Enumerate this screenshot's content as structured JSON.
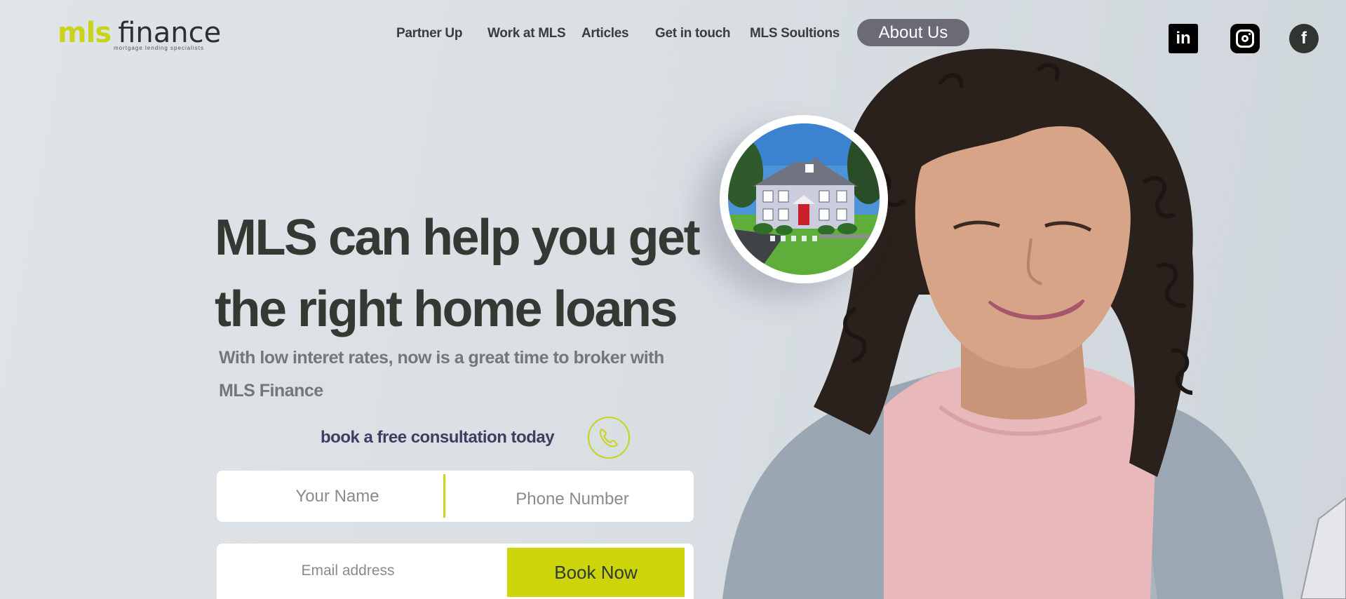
{
  "logo": {
    "brand": "mls",
    "name": "finance",
    "tagline": "mortgage lending specialists"
  },
  "nav": {
    "items": [
      {
        "label": "Partner Up"
      },
      {
        "label": "Work at MLS"
      },
      {
        "label": "Articles"
      },
      {
        "label": "Get in touch"
      },
      {
        "label": "MLS Soultions"
      }
    ],
    "about_label": "About Us"
  },
  "social": {
    "linkedin_glyph": "in",
    "facebook_glyph": "f",
    "icons": [
      "linkedin-icon",
      "instagram-icon",
      "facebook-icon"
    ]
  },
  "hero": {
    "headline_line1": "MLS can help you get",
    "headline_line2": "the right home loans",
    "subhead_line1": "With low interet rates, now is a great time to broker with",
    "subhead_line2": "MLS Finance",
    "cta": "book a free consultation today"
  },
  "form": {
    "name_placeholder": "Your Name",
    "phone_placeholder": "Phone Number",
    "email_placeholder": "Email address",
    "submit_label": "Book Now"
  },
  "colors": {
    "accent": "#c9d31a",
    "headline": "#333a33",
    "cta_text": "#3f3d62",
    "about_button": "#6c6a75"
  }
}
